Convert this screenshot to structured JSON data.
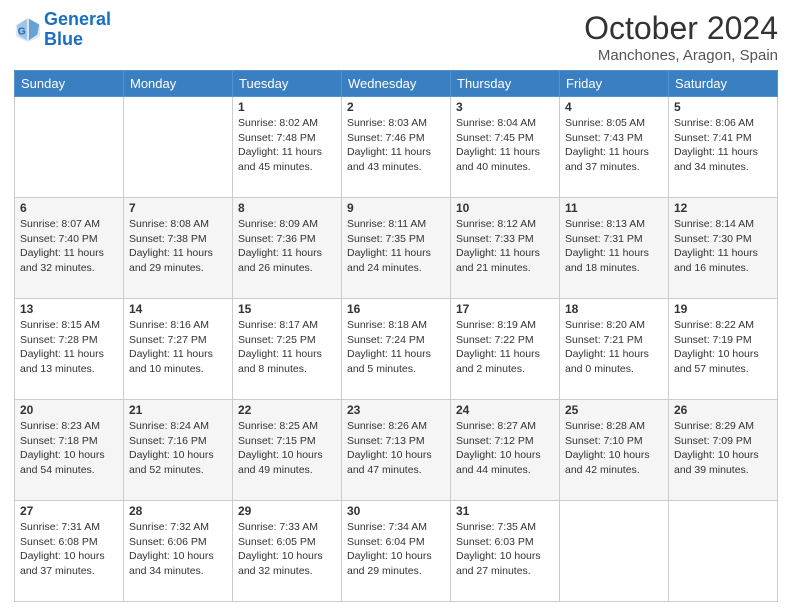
{
  "header": {
    "logo_line1": "General",
    "logo_line2": "Blue",
    "month": "October 2024",
    "location": "Manchones, Aragon, Spain"
  },
  "weekdays": [
    "Sunday",
    "Monday",
    "Tuesday",
    "Wednesday",
    "Thursday",
    "Friday",
    "Saturday"
  ],
  "rows": [
    [
      {
        "day": "",
        "info": ""
      },
      {
        "day": "",
        "info": ""
      },
      {
        "day": "1",
        "info": "Sunrise: 8:02 AM\nSunset: 7:48 PM\nDaylight: 11 hours and 45 minutes."
      },
      {
        "day": "2",
        "info": "Sunrise: 8:03 AM\nSunset: 7:46 PM\nDaylight: 11 hours and 43 minutes."
      },
      {
        "day": "3",
        "info": "Sunrise: 8:04 AM\nSunset: 7:45 PM\nDaylight: 11 hours and 40 minutes."
      },
      {
        "day": "4",
        "info": "Sunrise: 8:05 AM\nSunset: 7:43 PM\nDaylight: 11 hours and 37 minutes."
      },
      {
        "day": "5",
        "info": "Sunrise: 8:06 AM\nSunset: 7:41 PM\nDaylight: 11 hours and 34 minutes."
      }
    ],
    [
      {
        "day": "6",
        "info": "Sunrise: 8:07 AM\nSunset: 7:40 PM\nDaylight: 11 hours and 32 minutes."
      },
      {
        "day": "7",
        "info": "Sunrise: 8:08 AM\nSunset: 7:38 PM\nDaylight: 11 hours and 29 minutes."
      },
      {
        "day": "8",
        "info": "Sunrise: 8:09 AM\nSunset: 7:36 PM\nDaylight: 11 hours and 26 minutes."
      },
      {
        "day": "9",
        "info": "Sunrise: 8:11 AM\nSunset: 7:35 PM\nDaylight: 11 hours and 24 minutes."
      },
      {
        "day": "10",
        "info": "Sunrise: 8:12 AM\nSunset: 7:33 PM\nDaylight: 11 hours and 21 minutes."
      },
      {
        "day": "11",
        "info": "Sunrise: 8:13 AM\nSunset: 7:31 PM\nDaylight: 11 hours and 18 minutes."
      },
      {
        "day": "12",
        "info": "Sunrise: 8:14 AM\nSunset: 7:30 PM\nDaylight: 11 hours and 16 minutes."
      }
    ],
    [
      {
        "day": "13",
        "info": "Sunrise: 8:15 AM\nSunset: 7:28 PM\nDaylight: 11 hours and 13 minutes."
      },
      {
        "day": "14",
        "info": "Sunrise: 8:16 AM\nSunset: 7:27 PM\nDaylight: 11 hours and 10 minutes."
      },
      {
        "day": "15",
        "info": "Sunrise: 8:17 AM\nSunset: 7:25 PM\nDaylight: 11 hours and 8 minutes."
      },
      {
        "day": "16",
        "info": "Sunrise: 8:18 AM\nSunset: 7:24 PM\nDaylight: 11 hours and 5 minutes."
      },
      {
        "day": "17",
        "info": "Sunrise: 8:19 AM\nSunset: 7:22 PM\nDaylight: 11 hours and 2 minutes."
      },
      {
        "day": "18",
        "info": "Sunrise: 8:20 AM\nSunset: 7:21 PM\nDaylight: 11 hours and 0 minutes."
      },
      {
        "day": "19",
        "info": "Sunrise: 8:22 AM\nSunset: 7:19 PM\nDaylight: 10 hours and 57 minutes."
      }
    ],
    [
      {
        "day": "20",
        "info": "Sunrise: 8:23 AM\nSunset: 7:18 PM\nDaylight: 10 hours and 54 minutes."
      },
      {
        "day": "21",
        "info": "Sunrise: 8:24 AM\nSunset: 7:16 PM\nDaylight: 10 hours and 52 minutes."
      },
      {
        "day": "22",
        "info": "Sunrise: 8:25 AM\nSunset: 7:15 PM\nDaylight: 10 hours and 49 minutes."
      },
      {
        "day": "23",
        "info": "Sunrise: 8:26 AM\nSunset: 7:13 PM\nDaylight: 10 hours and 47 minutes."
      },
      {
        "day": "24",
        "info": "Sunrise: 8:27 AM\nSunset: 7:12 PM\nDaylight: 10 hours and 44 minutes."
      },
      {
        "day": "25",
        "info": "Sunrise: 8:28 AM\nSunset: 7:10 PM\nDaylight: 10 hours and 42 minutes."
      },
      {
        "day": "26",
        "info": "Sunrise: 8:29 AM\nSunset: 7:09 PM\nDaylight: 10 hours and 39 minutes."
      }
    ],
    [
      {
        "day": "27",
        "info": "Sunrise: 7:31 AM\nSunset: 6:08 PM\nDaylight: 10 hours and 37 minutes."
      },
      {
        "day": "28",
        "info": "Sunrise: 7:32 AM\nSunset: 6:06 PM\nDaylight: 10 hours and 34 minutes."
      },
      {
        "day": "29",
        "info": "Sunrise: 7:33 AM\nSunset: 6:05 PM\nDaylight: 10 hours and 32 minutes."
      },
      {
        "day": "30",
        "info": "Sunrise: 7:34 AM\nSunset: 6:04 PM\nDaylight: 10 hours and 29 minutes."
      },
      {
        "day": "31",
        "info": "Sunrise: 7:35 AM\nSunset: 6:03 PM\nDaylight: 10 hours and 27 minutes."
      },
      {
        "day": "",
        "info": ""
      },
      {
        "day": "",
        "info": ""
      }
    ]
  ]
}
